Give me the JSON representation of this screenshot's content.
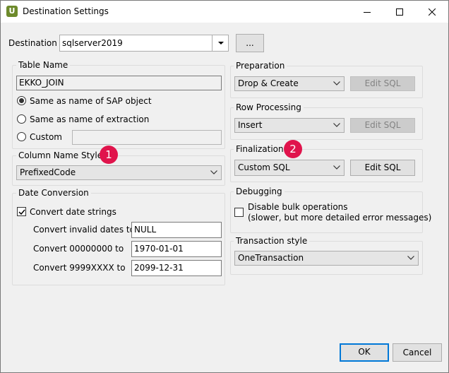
{
  "window": {
    "title": "Destination Settings",
    "app_icon_letter": "U"
  },
  "destination": {
    "label": "Destination",
    "value": "sqlserver2019",
    "browse_label": "..."
  },
  "table_name": {
    "title": "Table Name",
    "value": "EKKO_JOIN",
    "options": [
      {
        "label": "Same as name of SAP object",
        "checked": true
      },
      {
        "label": "Same as name of extraction",
        "checked": false
      },
      {
        "label": "Custom",
        "checked": false
      }
    ],
    "custom_value": ""
  },
  "column_name_style": {
    "title": "Column Name Style",
    "value": "PrefixedCode",
    "badge": "1"
  },
  "date_conversion": {
    "title": "Date Conversion",
    "convert_label": "Convert date strings",
    "checked": true,
    "rows": [
      {
        "label": "Convert invalid dates to",
        "value": "NULL"
      },
      {
        "label": "Convert 00000000 to",
        "value": "1970-01-01"
      },
      {
        "label": "Convert 9999XXXX to",
        "value": "2099-12-31"
      }
    ]
  },
  "preparation": {
    "title": "Preparation",
    "value": "Drop & Create",
    "edit_label": "Edit SQL"
  },
  "row_processing": {
    "title": "Row Processing",
    "value": "Insert",
    "edit_label": "Edit SQL"
  },
  "finalization": {
    "title": "Finalization",
    "value": "Custom SQL",
    "edit_label": "Edit SQL",
    "badge": "2"
  },
  "debugging": {
    "title": "Debugging",
    "label_line1": "Disable bulk operations",
    "label_line2": "(slower, but more detailed error messages)",
    "checked": false
  },
  "transaction_style": {
    "title": "Transaction style",
    "value": "OneTransaction"
  },
  "footer": {
    "ok_label": "OK",
    "cancel_label": "Cancel"
  },
  "colors": {
    "badge": "#e0144c",
    "focus_blue": "#0078d7",
    "app_icon": "#6d8a2b"
  }
}
